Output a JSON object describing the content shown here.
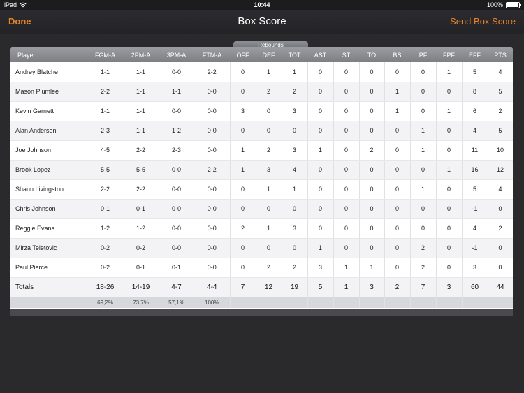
{
  "status": {
    "device": "iPad",
    "time": "10:44",
    "battery": "100%"
  },
  "nav": {
    "done": "Done",
    "title": "Box Score",
    "send": "Send Box Score"
  },
  "rebounds_label": "Rebounds",
  "columns": [
    "Player",
    "FGM-A",
    "2PM-A",
    "3PM-A",
    "FTM-A",
    "OFF",
    "DEF",
    "TOT",
    "AST",
    "ST",
    "TO",
    "BS",
    "PF",
    "FPF",
    "EFF",
    "PTS"
  ],
  "rows": [
    [
      "Andrey Blatche",
      "1-1",
      "1-1",
      "0-0",
      "2-2",
      "0",
      "1",
      "1",
      "0",
      "0",
      "0",
      "0",
      "0",
      "1",
      "5",
      "4"
    ],
    [
      "Mason Plumlee",
      "2-2",
      "1-1",
      "1-1",
      "0-0",
      "0",
      "2",
      "2",
      "0",
      "0",
      "0",
      "1",
      "0",
      "0",
      "8",
      "5"
    ],
    [
      "Kevin Garnett",
      "1-1",
      "1-1",
      "0-0",
      "0-0",
      "3",
      "0",
      "3",
      "0",
      "0",
      "0",
      "1",
      "0",
      "1",
      "6",
      "2"
    ],
    [
      "Alan Anderson",
      "2-3",
      "1-1",
      "1-2",
      "0-0",
      "0",
      "0",
      "0",
      "0",
      "0",
      "0",
      "0",
      "1",
      "0",
      "4",
      "5"
    ],
    [
      "Joe Johnson",
      "4-5",
      "2-2",
      "2-3",
      "0-0",
      "1",
      "2",
      "3",
      "1",
      "0",
      "2",
      "0",
      "1",
      "0",
      "11",
      "10"
    ],
    [
      "Brook Lopez",
      "5-5",
      "5-5",
      "0-0",
      "2-2",
      "1",
      "3",
      "4",
      "0",
      "0",
      "0",
      "0",
      "0",
      "1",
      "16",
      "12"
    ],
    [
      "Shaun Livingston",
      "2-2",
      "2-2",
      "0-0",
      "0-0",
      "0",
      "1",
      "1",
      "0",
      "0",
      "0",
      "0",
      "1",
      "0",
      "5",
      "4"
    ],
    [
      "Chris Johnson",
      "0-1",
      "0-1",
      "0-0",
      "0-0",
      "0",
      "0",
      "0",
      "0",
      "0",
      "0",
      "0",
      "0",
      "0",
      "-1",
      "0"
    ],
    [
      "Reggie Evans",
      "1-2",
      "1-2",
      "0-0",
      "0-0",
      "2",
      "1",
      "3",
      "0",
      "0",
      "0",
      "0",
      "0",
      "0",
      "4",
      "2"
    ],
    [
      "Mirza Teletovic",
      "0-2",
      "0-2",
      "0-0",
      "0-0",
      "0",
      "0",
      "0",
      "1",
      "0",
      "0",
      "0",
      "2",
      "0",
      "-1",
      "0"
    ],
    [
      "Paul Pierce",
      "0-2",
      "0-1",
      "0-1",
      "0-0",
      "0",
      "2",
      "2",
      "3",
      "1",
      "1",
      "0",
      "2",
      "0",
      "3",
      "0"
    ],
    [
      "Totals",
      "18-26",
      "14-19",
      "4-7",
      "4-4",
      "7",
      "12",
      "19",
      "5",
      "1",
      "3",
      "2",
      "7",
      "3",
      "60",
      "44"
    ]
  ],
  "percentages": [
    "",
    "69,2%",
    "73,7%",
    "57,1%",
    "100%",
    "",
    "",
    "",
    "",
    "",
    "",
    "",
    "",
    "",
    "",
    ""
  ]
}
